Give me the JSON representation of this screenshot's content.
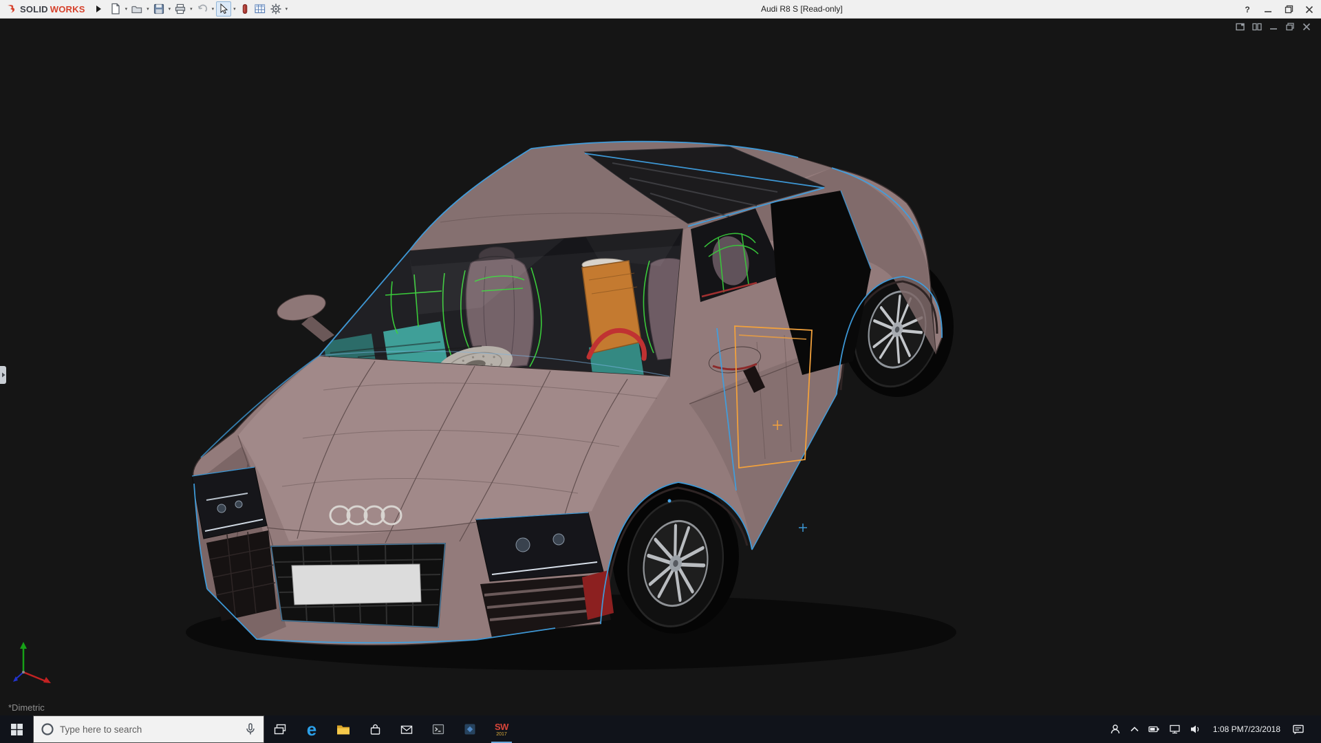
{
  "window": {
    "brand": {
      "solid": "SOLID",
      "works": "WORKS"
    },
    "title": "Audi R8 S [Read-only]",
    "help_label": "?"
  },
  "toolbar": {
    "icons": [
      {
        "name": "new-document-icon"
      },
      {
        "name": "open-folder-icon"
      },
      {
        "name": "save-icon"
      },
      {
        "name": "print-icon"
      },
      {
        "name": "undo-icon"
      },
      {
        "name": "select-arrow-icon"
      },
      {
        "name": "red-capsule-icon"
      },
      {
        "name": "spreadsheet-icon"
      },
      {
        "name": "options-gear-icon"
      }
    ]
  },
  "viewport": {
    "view_orientation_label": "*Dimetric",
    "colors": {
      "background": "#151515",
      "body_paint": "#937b7b",
      "selected_edge_blue": "#3f9fe0",
      "sketch_orange": "#f2a13c",
      "wireframe_green": "#3cd43c",
      "interior_teal": "#3f9f98"
    }
  },
  "taskbar": {
    "search_placeholder": "Type here to search",
    "edge_glyph": "e",
    "solidworks_badge": {
      "letters": "SW",
      "year": "2017"
    },
    "clock": {
      "time": "1:08 PM",
      "date": "7/23/2018"
    }
  }
}
